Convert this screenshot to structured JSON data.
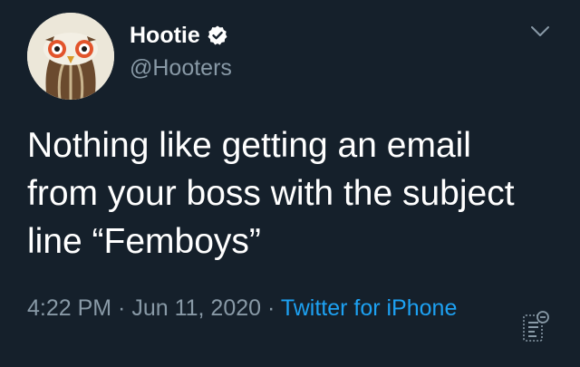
{
  "author": {
    "display_name": "Hootie",
    "handle": "@Hooters",
    "verified": true
  },
  "tweet": {
    "text": "Nothing like getting an email\nfrom your boss with the subject\nline “Femboys”",
    "time": "4:22 PM",
    "separator": " · ",
    "date": "Jun 11, 2020",
    "source": "Twitter for iPhone"
  },
  "icons": {
    "avatar": "owl-logo-icon",
    "verified": "verified-badge-icon",
    "menu": "chevron-down-icon",
    "analytics": "analytics-icon"
  },
  "colors": {
    "background": "#15202b",
    "text": "#ffffff",
    "secondary": "#8899a6",
    "link": "#1da1f2"
  }
}
